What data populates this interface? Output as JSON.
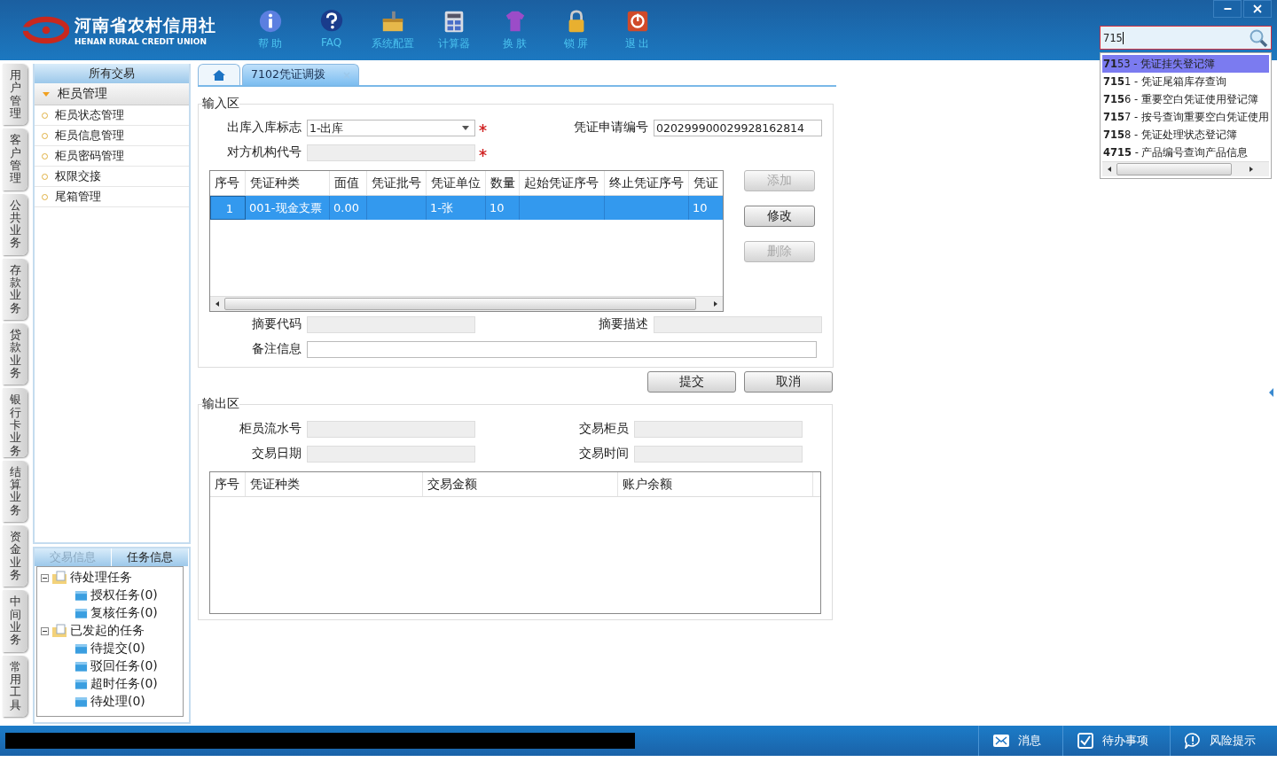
{
  "app": {
    "logo_text": "河南省农村信用社",
    "logo_subtitle": "HENAN RURAL CREDIT UNION"
  },
  "toolbar": [
    {
      "label": "帮 助",
      "kind": "info"
    },
    {
      "label": "FAQ",
      "kind": "faq"
    },
    {
      "label": "系统配置",
      "kind": "config"
    },
    {
      "label": "计算器",
      "kind": "calculator"
    },
    {
      "label": "换 肤",
      "kind": "skin"
    },
    {
      "label": "锁 屏",
      "kind": "lock"
    },
    {
      "label": "退 出",
      "kind": "exit"
    }
  ],
  "search": {
    "value": "715",
    "suggestions": [
      {
        "text": "**71**53 - 凭证挂失登记簿",
        "selected": true
      },
      {
        "text": "**715**1 - 凭证尾箱库存查询",
        "selected": false
      },
      {
        "text": "**715**6 - 重要空白凭证使用登记簿",
        "selected": false
      },
      {
        "text": "**715**7 - 按号查询重要空白凭证使用",
        "selected": false
      },
      {
        "text": "**715**8 - 凭证处理状态登记簿",
        "selected": false
      },
      {
        "text": "**4715** - 产品编号查询产品信息",
        "selected": false
      }
    ]
  },
  "side_tabs": [
    "用户管理",
    "客户管理",
    "公共业务",
    "存款业务",
    "贷款业务",
    "银行卡业务",
    "结算业务",
    "资金业务",
    "中间业务",
    "常用工具"
  ],
  "nav": {
    "title": "所有交易",
    "groups": [
      {
        "label": "柜员管理",
        "expanded": true,
        "children": [
          "柜员状态管理",
          "柜员信息管理",
          "柜员密码管理",
          "权限交接",
          "尾箱管理"
        ]
      }
    ]
  },
  "task_panel": {
    "tabs": [
      {
        "label": "交易信息",
        "selected": false
      },
      {
        "label": "任务信息",
        "selected": true
      }
    ],
    "tree": [
      {
        "label": "待处理任务",
        "expanded": true,
        "children": [
          "授权任务(0)",
          "复核任务(0)"
        ]
      },
      {
        "label": "已发起的任务",
        "expanded": true,
        "children": [
          "待提交(0)",
          "驳回任务(0)",
          "超时任务(0)",
          "待处理(0)"
        ]
      }
    ]
  },
  "content_tabs": [
    {
      "kind": "home",
      "selected": false
    },
    {
      "kind": "page",
      "label": "7102凭证调拨",
      "selected": true,
      "closable": true
    }
  ],
  "input_section": {
    "title": "输入区",
    "direction": {
      "label": "出库入库标志",
      "value": "1-出库",
      "required": true
    },
    "counterparty": {
      "label": "对方机构代号",
      "required": true,
      "disabled": true
    },
    "application_no": {
      "label": "凭证申请编号",
      "value": "020299900029928162814"
    },
    "grid": {
      "columns": [
        "序号",
        "凭证种类",
        "面值",
        "凭证批号",
        "凭证单位",
        "数量",
        "起始凭证序号",
        "终止凭证序号",
        "凭证"
      ],
      "rows": [
        {
          "selected": true,
          "cells": [
            "1",
            "001-现金支票",
            "0.00",
            "",
            "1-张",
            "10",
            "",
            "",
            "10"
          ]
        }
      ]
    },
    "actions": [
      {
        "label": "添加",
        "disabled": true
      },
      {
        "label": "修改",
        "disabled": false
      },
      {
        "label": "删除",
        "disabled": true
      }
    ],
    "summary_code": {
      "label": "摘要代码",
      "disabled": true
    },
    "summary_desc": {
      "label": "摘要描述",
      "disabled": true
    },
    "remark": {
      "label": "备注信息",
      "disabled": false
    }
  },
  "form_actions": [
    {
      "label": "提交"
    },
    {
      "label": "取消"
    }
  ],
  "output_section": {
    "title": "输出区",
    "fields": [
      {
        "label": "柜员流水号"
      },
      {
        "label": "交易柜员"
      },
      {
        "label": "交易日期"
      },
      {
        "label": "交易时间"
      }
    ],
    "grid": {
      "columns": [
        "序号",
        "凭证种类",
        "交易金额",
        "账户余额"
      ]
    }
  },
  "status_bar": {
    "items": [
      {
        "label": "消息",
        "kind": "mail"
      },
      {
        "label": "待办事项",
        "kind": "check"
      },
      {
        "label": "风险提示",
        "kind": "alert"
      }
    ]
  }
}
